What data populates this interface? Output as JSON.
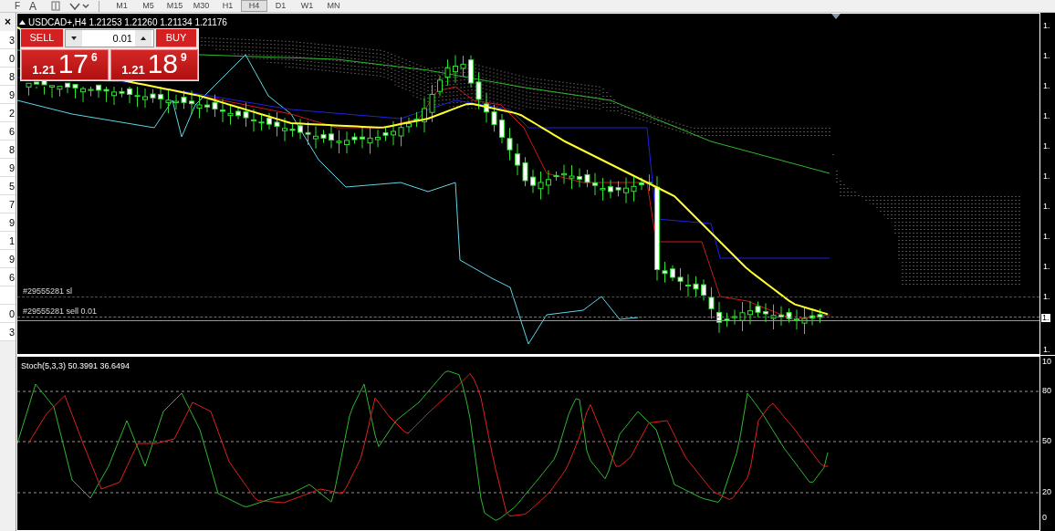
{
  "toolbar": {
    "left_glyph": "F",
    "text_tool": "A",
    "timeframes": [
      {
        "label": "M1",
        "selected": false
      },
      {
        "label": "M5",
        "selected": false
      },
      {
        "label": "M15",
        "selected": false
      },
      {
        "label": "M30",
        "selected": false
      },
      {
        "label": "H1",
        "selected": false
      },
      {
        "label": "H4",
        "selected": true
      },
      {
        "label": "D1",
        "selected": false
      },
      {
        "label": "W1",
        "selected": false
      },
      {
        "label": "MN",
        "selected": false
      }
    ]
  },
  "side_panel": {
    "close": "×",
    "rows": [
      "3",
      "0",
      "8",
      "9",
      "2",
      "6",
      "8",
      "9",
      "5",
      "7",
      "9",
      "1",
      "9",
      "6",
      "",
      "0",
      "3"
    ]
  },
  "chart": {
    "title": "USDCAD+,H4  1.21253 1.21260 1.21134 1.21176",
    "trade_panel": {
      "sell": "SELL",
      "buy": "BUY",
      "lot": "0.01",
      "sell_price": {
        "prefix": "1.21",
        "big": "17",
        "sup": "6"
      },
      "buy_price": {
        "prefix": "1.21",
        "big": "18",
        "sup": "9"
      }
    },
    "order_lines": [
      {
        "label": "#29555281 sl",
        "kind": "sl"
      },
      {
        "label": "#29555281 sell 0.01",
        "kind": "entry"
      }
    ],
    "price_axis": [
      "1.",
      "1.",
      "1.",
      "1.",
      "1.",
      "1.",
      "1.",
      "1.",
      "1.",
      "1.",
      "1."
    ],
    "current_price": "1."
  },
  "indicator": {
    "label": "Stoch(5,3,3) 50.3991 36.6494",
    "axis": [
      "10",
      "80",
      "50",
      "20",
      "0"
    ]
  }
}
